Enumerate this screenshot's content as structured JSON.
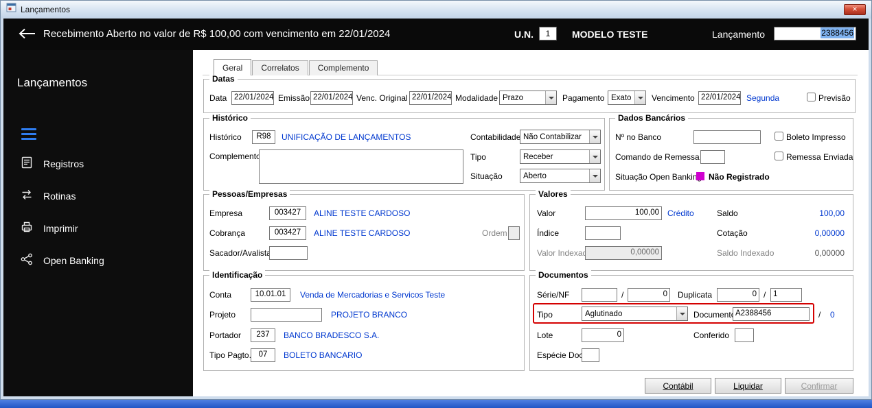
{
  "window": {
    "title": "Lançamentos"
  },
  "header": {
    "message": "Recebimento Aberto no valor de R$ 100,00 com vencimento em 22/01/2024",
    "un_label": "U.N.",
    "un_value": "1",
    "model_name": "MODELO TESTE",
    "lancamento_label": "Lançamento",
    "lancamento_value": "2388456"
  },
  "sidebar": {
    "title": "Lançamentos",
    "items": [
      {
        "label": "Registros",
        "icon": "registros-icon"
      },
      {
        "label": "Rotinas",
        "icon": "rotinas-icon"
      },
      {
        "label": "Imprimir",
        "icon": "imprimir-icon"
      },
      {
        "label": "Open Banking",
        "icon": "open-banking-icon"
      }
    ]
  },
  "tabs": [
    {
      "label": "Geral",
      "active": true
    },
    {
      "label": "Correlatos",
      "active": false
    },
    {
      "label": "Complemento",
      "active": false
    }
  ],
  "datas": {
    "title": "Datas",
    "data_label": "Data",
    "data_value": "22/01/2024",
    "emissao_label": "Emissão",
    "emissao_value": "22/01/2024",
    "venc_original_label": "Venc. Original",
    "venc_original_value": "22/01/2024",
    "modalidade_label": "Modalidade",
    "modalidade_value": "Prazo",
    "pagamento_label": "Pagamento",
    "pagamento_value": "Exato",
    "vencimento_label": "Vencimento",
    "vencimento_value": "22/01/2024",
    "dia_semana": "Segunda",
    "previsao_label": "Previsão"
  },
  "historico": {
    "title": "Histórico",
    "historico_label": "Histórico",
    "historico_code": "R98",
    "historico_desc": "UNIFICAÇÃO DE LANÇAMENTOS",
    "complemento_label": "Complemento",
    "complemento_value": "",
    "contabilidade_label": "Contabilidade",
    "contabilidade_value": "Não Contabilizar",
    "tipo_label": "Tipo",
    "tipo_value": "Receber",
    "situacao_label": "Situação",
    "situacao_value": "Aberto"
  },
  "dados_bancarios": {
    "title": "Dados Bancários",
    "numero_banco_label": "Nº no Banco",
    "numero_banco_value": "",
    "boleto_impresso_label": "Boleto Impresso",
    "comando_remessa_label": "Comando de Remessa",
    "comando_remessa_value": "",
    "remessa_enviada_label": "Remessa Enviada",
    "situacao_ob_label": "Situação Open Banking",
    "situacao_ob_value": "Não Registrado"
  },
  "pessoas": {
    "title": "Pessoas/Empresas",
    "empresa_label": "Empresa",
    "empresa_code": "003427",
    "empresa_name": "ALINE TESTE CARDOSO",
    "cobranca_label": "Cobrança",
    "cobranca_code": "003427",
    "cobranca_name": "ALINE TESTE CARDOSO",
    "ordem_label": "Ordem",
    "ordem_value": "",
    "sacador_label": "Sacador/Avalista",
    "sacador_value": ""
  },
  "valores": {
    "title": "Valores",
    "valor_label": "Valor",
    "valor_value": "100,00",
    "credito_label": "Crédito",
    "saldo_label": "Saldo",
    "saldo_value": "100,00",
    "indice_label": "Índice",
    "indice_value": "",
    "cotacao_label": "Cotação",
    "cotacao_value": "0,00000",
    "valor_indexado_label": "Valor Indexado",
    "valor_indexado_value": "0,00000",
    "saldo_indexado_label": "Saldo Indexado",
    "saldo_indexado_value": "0,00000"
  },
  "identificacao": {
    "title": "Identificação",
    "conta_label": "Conta",
    "conta_code": "10.01.01",
    "conta_desc": "Venda de Mercadorias e Servicos Teste",
    "projeto_label": "Projeto",
    "projeto_value": "",
    "projeto_desc": "PROJETO BRANCO",
    "portador_label": "Portador",
    "portador_code": "237",
    "portador_desc": "BANCO BRADESCO S.A.",
    "tipo_pagto_label": "Tipo Pagto.",
    "tipo_pagto_code": "07",
    "tipo_pagto_desc": "BOLETO BANCARIO"
  },
  "documentos": {
    "title": "Documentos",
    "serie_label": "Série/NF",
    "serie_value": "",
    "serie_num": "0",
    "duplicata_label": "Duplicata",
    "duplicata_value": "0",
    "duplicata_num": "1",
    "separator": "/",
    "tipo_label": "Tipo",
    "tipo_value": "Aglutinado",
    "documento_label": "Documento",
    "documento_value": "A2388456",
    "documento_num": "0",
    "lote_label": "Lote",
    "lote_value": "0",
    "conferido_label": "Conferido",
    "conferido_value": "",
    "especie_label": "Espécie Doc.",
    "especie_value": ""
  },
  "footer": {
    "contabil_label": "Contábil",
    "liquidar_label": "Liquidar",
    "confirmar_label": "Confirmar"
  },
  "colors": {
    "link_blue": "#0038cf",
    "highlight_red": "#d40000",
    "open_banking_magenta": "#cf00cf",
    "selection_blue": "#7fb2ef"
  }
}
